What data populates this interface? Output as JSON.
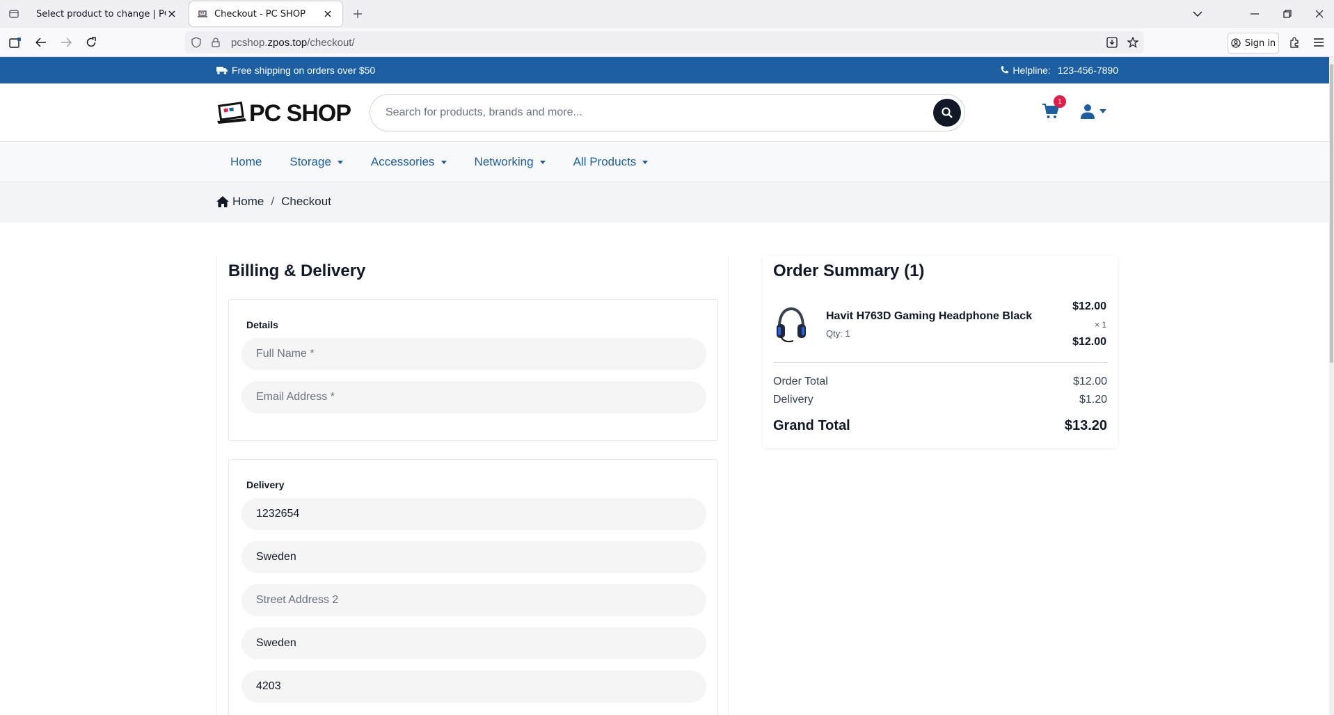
{
  "browser": {
    "tabs": [
      {
        "title": "Select product to change | PCSHOP",
        "active": false
      },
      {
        "title": "Checkout - PC SHOP",
        "active": true
      }
    ],
    "url_domain": "pcshop.",
    "url_host": "zpos.top",
    "url_path": "/checkout/",
    "sign_in_label": "Sign in"
  },
  "topbar": {
    "shipping_text": "Free shipping on orders over $50",
    "helpline_label": "Helpline:",
    "helpline_number": "123-456-7890"
  },
  "header": {
    "logo_text": "PC SHOP",
    "search_placeholder": "Search for products, brands and more...",
    "cart_count": "1"
  },
  "nav": {
    "items": [
      {
        "label": "Home",
        "dropdown": false
      },
      {
        "label": "Storage",
        "dropdown": true
      },
      {
        "label": "Accessories",
        "dropdown": true
      },
      {
        "label": "Networking",
        "dropdown": true
      },
      {
        "label": "All Products",
        "dropdown": true
      }
    ]
  },
  "breadcrumb": {
    "home": "Home",
    "separator": "/",
    "current": "Checkout"
  },
  "billing": {
    "title": "Billing & Delivery",
    "details_label": "Details",
    "full_name_placeholder": "Full Name *",
    "email_placeholder": "Email Address *",
    "delivery_label": "Delivery",
    "delivery_fields": [
      {
        "value": "1232654",
        "is_placeholder": false
      },
      {
        "value": "Sweden",
        "is_placeholder": false
      },
      {
        "value": "Street Address 2",
        "is_placeholder": true
      },
      {
        "value": "Sweden",
        "is_placeholder": false
      },
      {
        "value": "4203",
        "is_placeholder": false
      }
    ]
  },
  "summary": {
    "title": "Order Summary (1)",
    "product": {
      "name": "Havit H763D Gaming Headphone Black",
      "qty": "Qty: 1",
      "unit_price": "$12.00",
      "multiplier": "× 1",
      "line_total": "$12.00"
    },
    "order_total_label": "Order Total",
    "order_total": "$12.00",
    "delivery_label": "Delivery",
    "delivery": "$1.20",
    "grand_total_label": "Grand Total",
    "grand_total": "$13.20"
  },
  "colors": {
    "brand_blue": "#1b5fa2",
    "badge_red": "#e11d48",
    "search_button": "#111827"
  }
}
